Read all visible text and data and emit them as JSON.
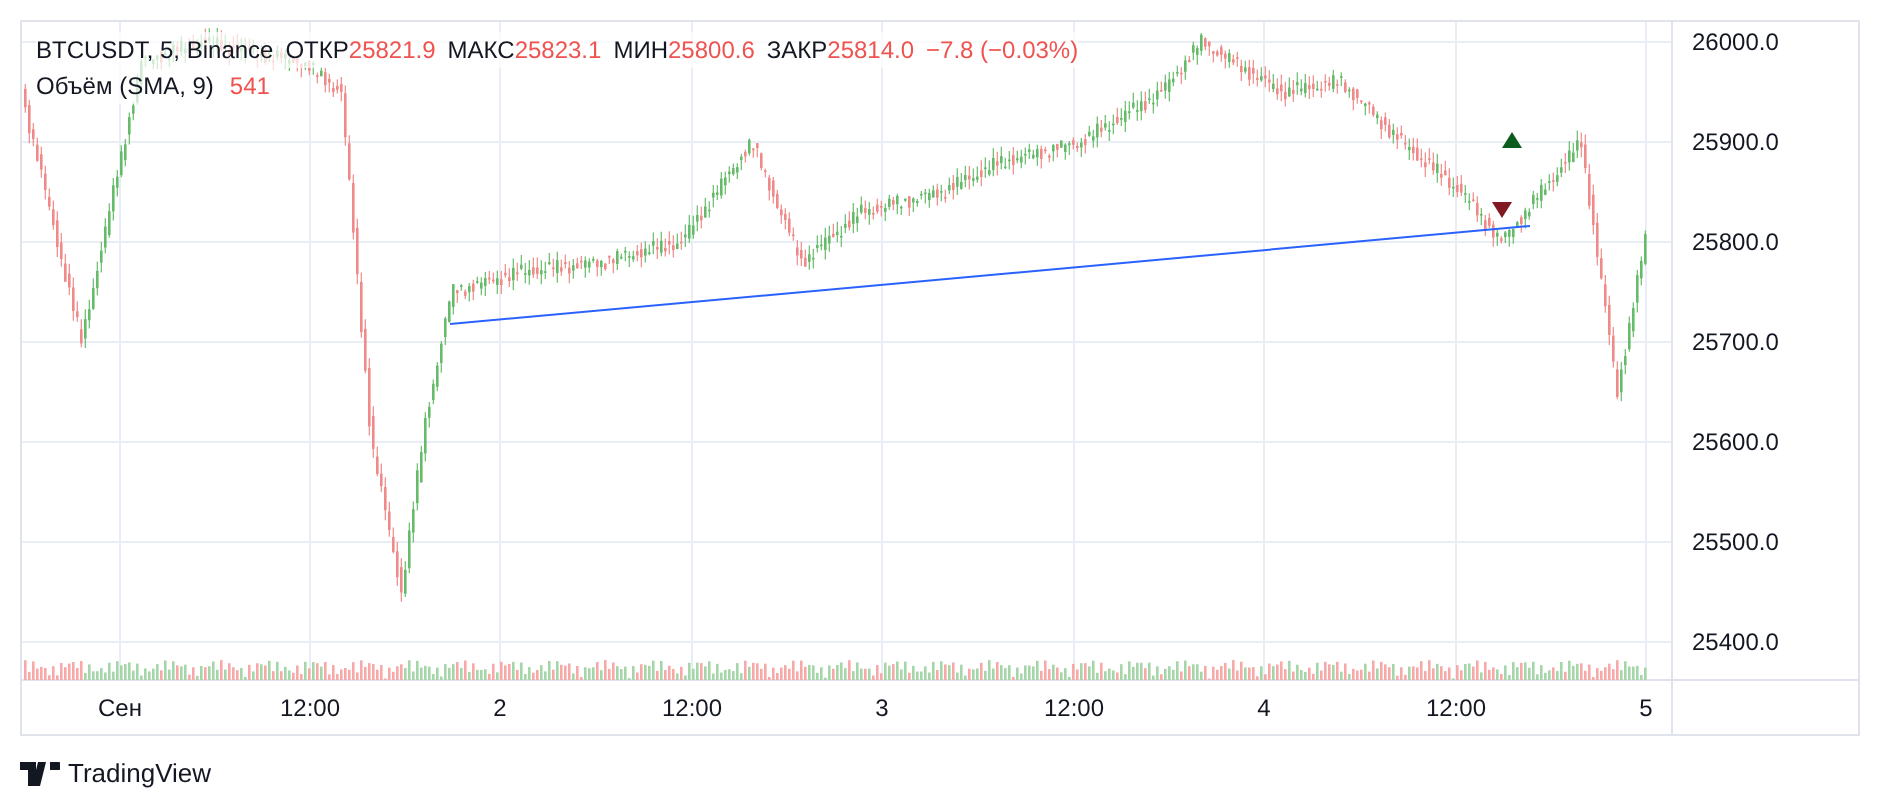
{
  "legend": {
    "symbol": "BTCUSDT, 5, Binance",
    "values": [
      {
        "label": "ОТКР",
        "value": "25821.9"
      },
      {
        "label": "МАКС",
        "value": "25823.1"
      },
      {
        "label": "МИН",
        "value": "25800.6"
      },
      {
        "label": "ЗАКР",
        "value": "25814.0"
      }
    ],
    "change": "−7.8 (−0.03%)",
    "volume_label": "Объём (SMA, 9)",
    "volume_value": "541"
  },
  "price_axis": [
    "26000.0",
    "25900.0",
    "25800.0",
    "25700.0",
    "25600.0",
    "25500.0",
    "25400.0"
  ],
  "time_axis": [
    "Сен",
    "12:00",
    "2",
    "12:00",
    "3",
    "12:00",
    "4",
    "12:00",
    "5"
  ],
  "footer": {
    "brand": "TradingView"
  }
}
